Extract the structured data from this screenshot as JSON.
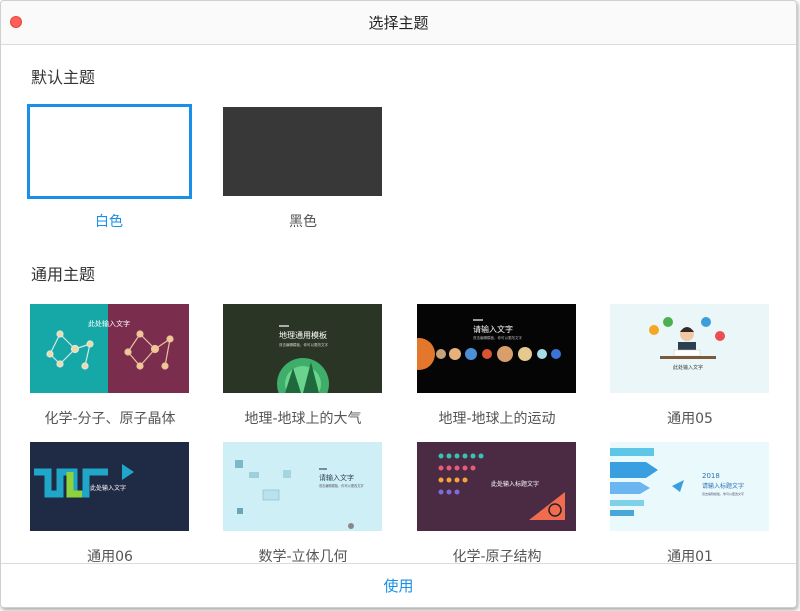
{
  "window": {
    "title": "选择主题"
  },
  "sections": {
    "default_title": "默认主题",
    "general_title": "通用主题"
  },
  "default_themes": [
    {
      "name": "白色",
      "selected": true,
      "color": "#ffffff"
    },
    {
      "name": "黑色",
      "selected": false,
      "color": "#383838"
    }
  ],
  "general_themes": [
    {
      "name": "化学-分子、原子晶体",
      "thumb_text": "此处输入文字"
    },
    {
      "name": "地理-地球上的大气",
      "thumb_text": "地理通用模板",
      "thumb_sub": "双击编辑模板，你可以更改文字"
    },
    {
      "name": "地理-地球上的运动",
      "thumb_text": "请输入文字",
      "thumb_sub": "双击编辑模板，你可以更改文字"
    },
    {
      "name": "通用05",
      "thumb_text": "此处输入文字"
    },
    {
      "name": "通用06",
      "thumb_text": "此处输入文字"
    },
    {
      "name": "数学-立体几何",
      "thumb_text": "请输入文字",
      "thumb_sub": "双击编辑模板，你可以更改文字"
    },
    {
      "name": "化学-原子结构",
      "thumb_text": "此处输入标题文字"
    },
    {
      "name": "通用01",
      "thumb_year": "2018",
      "thumb_text": "请输入标题文字",
      "thumb_sub": "双击编辑模板，你可以更改文字"
    }
  ],
  "footer": {
    "use_label": "使用"
  },
  "colors": {
    "accent": "#1a8fe8",
    "close": "#fe5f57"
  }
}
